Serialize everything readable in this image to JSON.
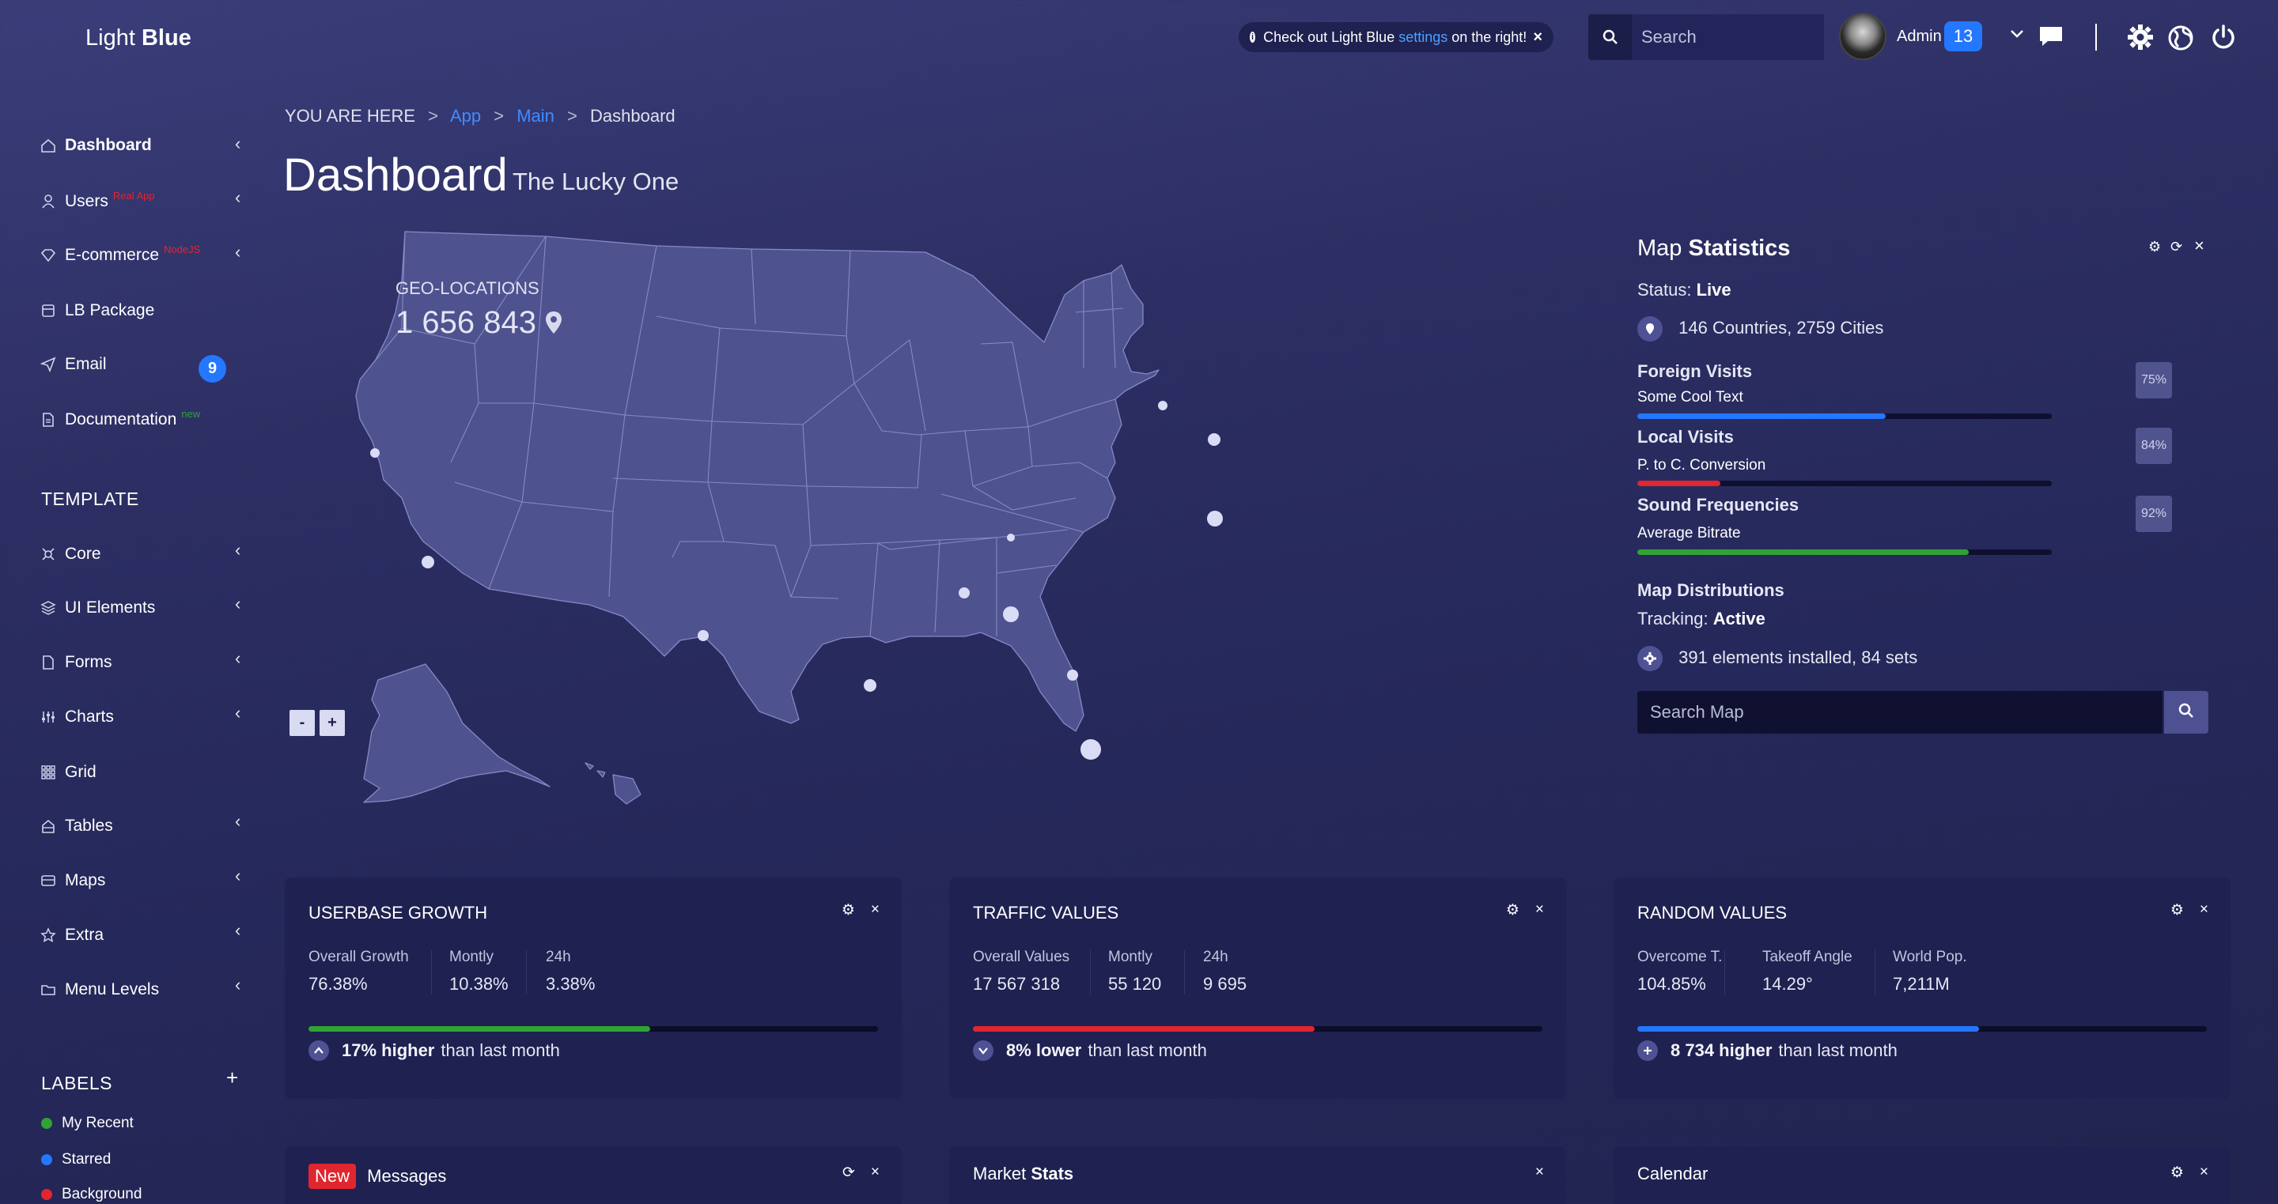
{
  "header": {
    "logo_light": "Light",
    "logo_bold": "Blue",
    "alert_prefix": "Check out Light Blue",
    "alert_link": "settings",
    "alert_suffix": "on the right!",
    "search_placeholder": "Search",
    "user_name": "Admin",
    "notification_count": "13"
  },
  "sidebar": {
    "items": [
      {
        "label": "Dashboard",
        "icon": "home-icon"
      },
      {
        "label": "Users",
        "tag": "Real App",
        "icon": "user-icon"
      },
      {
        "label": "E-commerce",
        "tag": "NodeJS",
        "icon": "diamond-icon"
      },
      {
        "label": "LB Package",
        "icon": "package-icon"
      },
      {
        "label": "Email",
        "badge": "9",
        "icon": "send-icon"
      },
      {
        "label": "Documentation",
        "tag": "new",
        "icon": "document-icon"
      }
    ],
    "template_heading": "TEMPLATE",
    "template_items": [
      {
        "label": "Core",
        "icon": "core-icon"
      },
      {
        "label": "UI Elements",
        "icon": "layers-icon"
      },
      {
        "label": "Forms",
        "icon": "forms-icon"
      },
      {
        "label": "Charts",
        "icon": "charts-icon"
      },
      {
        "label": "Grid",
        "icon": "grid-icon"
      },
      {
        "label": "Tables",
        "icon": "tables-icon"
      },
      {
        "label": "Maps",
        "icon": "maps-icon"
      },
      {
        "label": "Extra",
        "icon": "star-icon"
      },
      {
        "label": "Menu Levels",
        "icon": "folder-icon"
      }
    ],
    "labels_heading": "LABELS",
    "labels": [
      {
        "label": "My Recent",
        "color": "#2fa334"
      },
      {
        "label": "Starred",
        "color": "#2477ff"
      },
      {
        "label": "Background",
        "color": "#e0262f"
      }
    ]
  },
  "breadcrumb": {
    "prefix": "YOU ARE HERE",
    "items": [
      "App",
      "Main",
      "Dashboard"
    ]
  },
  "page": {
    "title": "Dashboard",
    "subtitle": "The Lucky One"
  },
  "map": {
    "geo_label": "GEO-LOCATIONS",
    "geo_value": "1 656 843",
    "zoom_out": "-",
    "zoom_in": "+"
  },
  "map_stats": {
    "title_light": "Map",
    "title_bold": "Statistics",
    "status_label": "Status:",
    "status_value": "Live",
    "countries": "146 Countries, 2759 Cities",
    "bars": [
      {
        "title": "Foreign Visits",
        "sub": "Some Cool Text",
        "pct": "75%",
        "fill": 0.6,
        "color": "#2477ff"
      },
      {
        "title": "Local Visits",
        "sub": "P. to C. Conversion",
        "pct": "84%",
        "fill": 0.2,
        "color": "#e0262f"
      },
      {
        "title": "Sound Frequencies",
        "sub": "Average Bitrate",
        "pct": "92%",
        "fill": 0.8,
        "color": "#2fa334"
      }
    ],
    "dist_title": "Map Distributions",
    "tracking_label": "Tracking:",
    "tracking_value": "Active",
    "elements": "391 elements installed, 84 sets",
    "search_placeholder": "Search Map"
  },
  "widgets": [
    {
      "title": "USERBASE GROWTH",
      "stats": [
        {
          "label": "Overall Growth",
          "value": "76.38%"
        },
        {
          "label": "Montly",
          "value": "10.38%"
        },
        {
          "label": "24h",
          "value": "3.38%"
        }
      ],
      "fill": 0.6,
      "color": "#2fa334",
      "foot_bold": "17% higher",
      "foot_text": "than last month"
    },
    {
      "title": "TRAFFIC VALUES",
      "stats": [
        {
          "label": "Overall Values",
          "value": "17 567 318"
        },
        {
          "label": "Montly",
          "value": "55 120"
        },
        {
          "label": "24h",
          "value": "9 695"
        }
      ],
      "fill": 0.6,
      "color": "#e0262f",
      "foot_bold": "8% lower",
      "foot_text": "than last month"
    },
    {
      "title": "RANDOM VALUES",
      "stats": [
        {
          "label": "Overcome T.",
          "value": "104.85%"
        },
        {
          "label": "Takeoff Angle",
          "value": "14.29°"
        },
        {
          "label": "World Pop.",
          "value": "7,211M"
        }
      ],
      "fill": 0.6,
      "color": "#2477ff",
      "foot_bold": "8 734 higher",
      "foot_text": "than last month"
    }
  ],
  "bottom_widgets": {
    "messages_badge": "New",
    "messages_title": "Messages",
    "market_light": "Market",
    "market_bold": "Stats",
    "calendar_title": "Calendar"
  }
}
